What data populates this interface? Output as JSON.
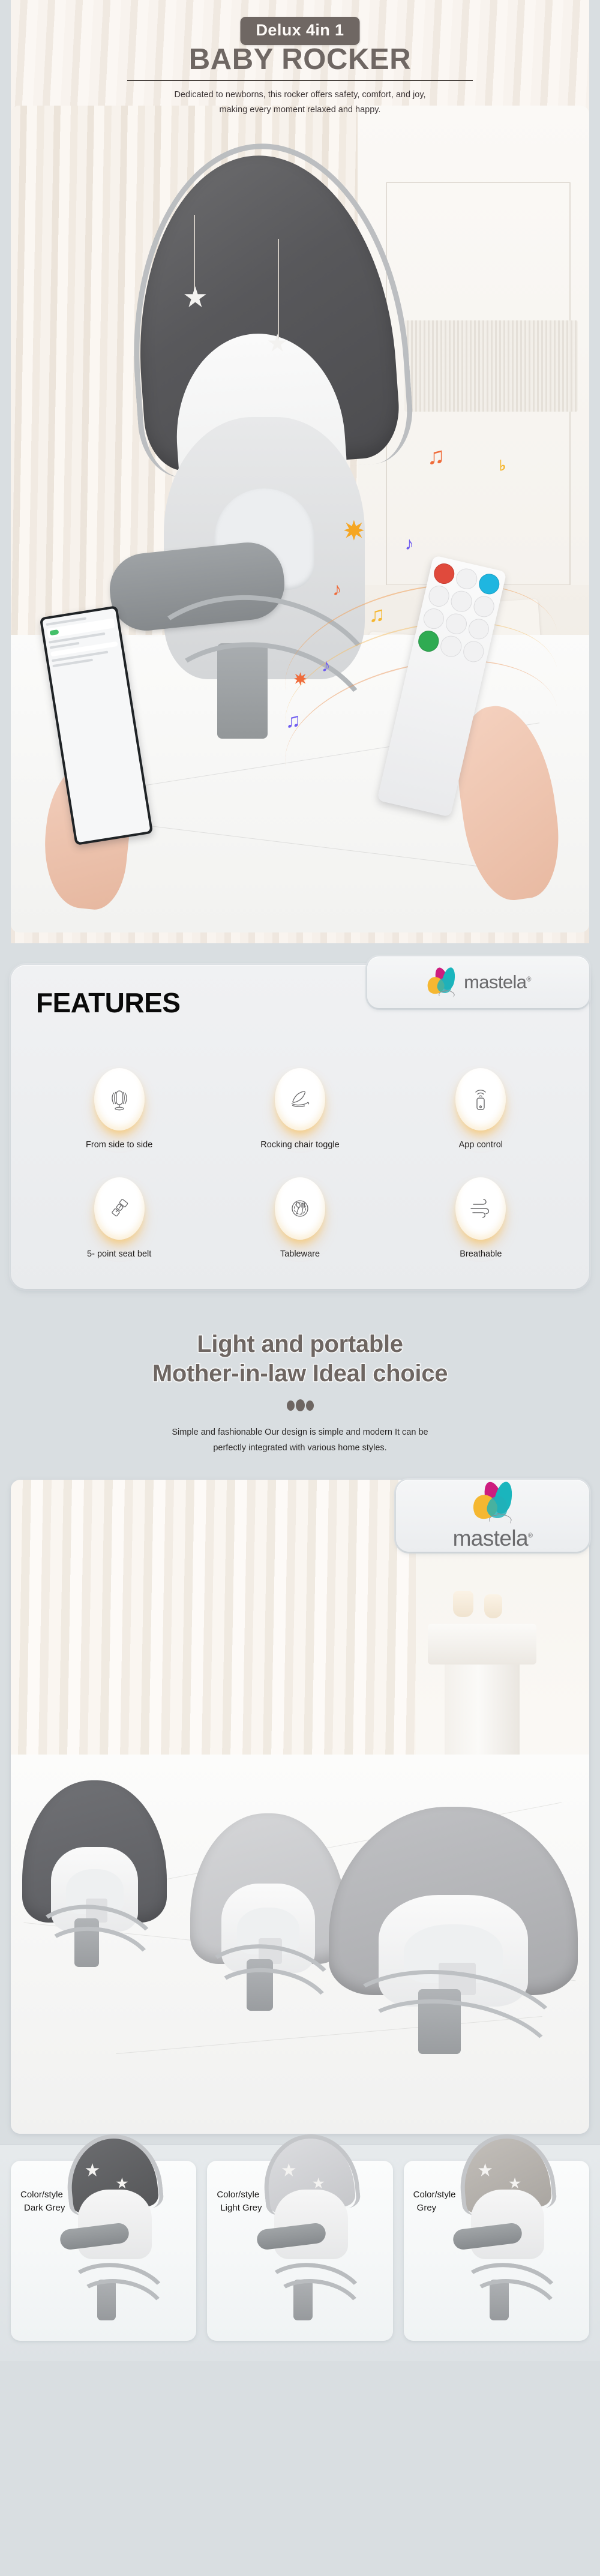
{
  "hero": {
    "badge": "Delux 4in 1",
    "title": "BABY ROCKER",
    "subtitle_line1": "Dedicated to newborns, this rocker offers safety, comfort, and joy,",
    "subtitle_line2": "making every moment relaxed and happy."
  },
  "brand": {
    "name": "mastela",
    "registered": "®",
    "logo_icon": "butterfly-logo",
    "colors": {
      "magenta": "#cd1d7e",
      "teal": "#1ab5bd",
      "yellow": "#f5b731",
      "text": "#6b6b6d"
    }
  },
  "features": {
    "title": "FEATURES",
    "items": [
      {
        "label": "From side to side",
        "icon": "rocker-swing-icon"
      },
      {
        "label": "Rocking chair toggle",
        "icon": "recline-seat-icon"
      },
      {
        "label": "App control",
        "icon": "phone-signal-icon"
      },
      {
        "label": "5- point seat belt",
        "icon": "seat-belt-buckle-icon"
      },
      {
        "label": "Tableware",
        "icon": "plate-cutlery-icon"
      },
      {
        "label": "Breathable",
        "icon": "airflow-icon"
      }
    ]
  },
  "slogan": {
    "heading_line1": "Light and portable",
    "heading_line2": "Mother-in-law Ideal choice",
    "divider_icon": "three-dots-ornament",
    "body_line1": "Simple and fashionable Our design is simple and modern It can be",
    "body_line2": "perfectly integrated with various home styles."
  },
  "colors_section": {
    "label": "Color/style",
    "options": [
      {
        "name": "Dark Grey",
        "swatch": "#5c5d61"
      },
      {
        "name": "Light Grey",
        "swatch": "#d5d6d8"
      },
      {
        "name": "Grey",
        "swatch": "#b4b0ab"
      }
    ]
  },
  "theme": {
    "page_background": "#d9dee1",
    "badge_background": "#6f6763",
    "heading_brown": "#6e6662",
    "glow": "#fab33c"
  }
}
